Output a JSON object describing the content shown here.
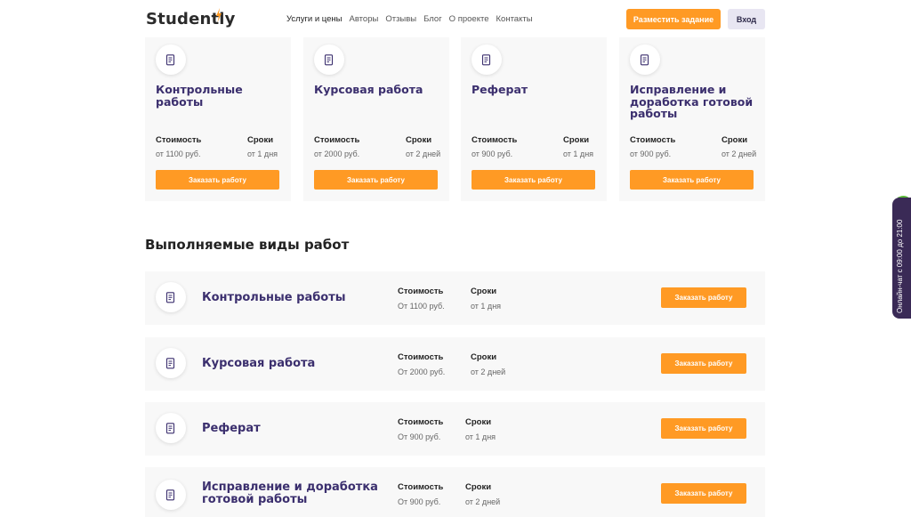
{
  "header": {
    "logo": "Studently",
    "nav": [
      "Услуги и цены",
      "Авторы",
      "Отзывы",
      "Блог",
      "О проекте",
      "Контакты"
    ],
    "order_button": "Разместить задание",
    "login_button": "Вход"
  },
  "cards": [
    {
      "title": "Контрольные работы",
      "cost_label": "Стоимость",
      "time_label": "Сроки",
      "cost": "от 1100 руб.",
      "time": "от 1 дня",
      "button": "Заказать работу"
    },
    {
      "title": "Курсовая работа",
      "cost_label": "Стоимость",
      "time_label": "Сроки",
      "cost": "от 2000 руб.",
      "time": "от 2 дней",
      "button": "Заказать работу"
    },
    {
      "title": "Реферат",
      "cost_label": "Стоимость",
      "time_label": "Сроки",
      "cost": "от 900 руб.",
      "time": "от 1 дня",
      "button": "Заказать работу"
    },
    {
      "title": "Исправление и доработка готовой работы",
      "cost_label": "Стоимость",
      "time_label": "Сроки",
      "cost": "от 900 руб.",
      "time": "от 2 дней",
      "button": "Заказать работу"
    }
  ],
  "section_title": "Выполняемые виды работ",
  "rows": [
    {
      "title": "Контрольные работы",
      "cost_label": "Стоимость",
      "time_label": "Сроки",
      "cost": "От 1100 руб.",
      "time": "от 1 дня",
      "button": "Заказать работу"
    },
    {
      "title": "Курсовая работа",
      "cost_label": "Стоимость",
      "time_label": "Сроки",
      "cost": "От 2000 руб.",
      "time": "от 2 дней",
      "button": "Заказать работу"
    },
    {
      "title": "Реферат",
      "cost_label": "Стоимость",
      "time_label": "Сроки",
      "cost": "От 900 руб.",
      "time": "от 1 дня",
      "button": "Заказать работу"
    },
    {
      "title": "Исправление и доработка готовой работы",
      "cost_label": "Стоимость",
      "time_label": "Сроки",
      "cost": "От 900 руб.",
      "time": "от 2 дней",
      "button": "Заказать работу"
    }
  ],
  "chat": {
    "label": "Онлайн-чат с 09:00 до 21:00"
  },
  "colors": {
    "accent": "#ff9a24",
    "title": "#3b2f6e",
    "chat_bg": "#3a2a56",
    "card_bg": "#f8f8f8"
  },
  "icons": {
    "work_type": "document-icon",
    "logo": "lightning-icon"
  }
}
